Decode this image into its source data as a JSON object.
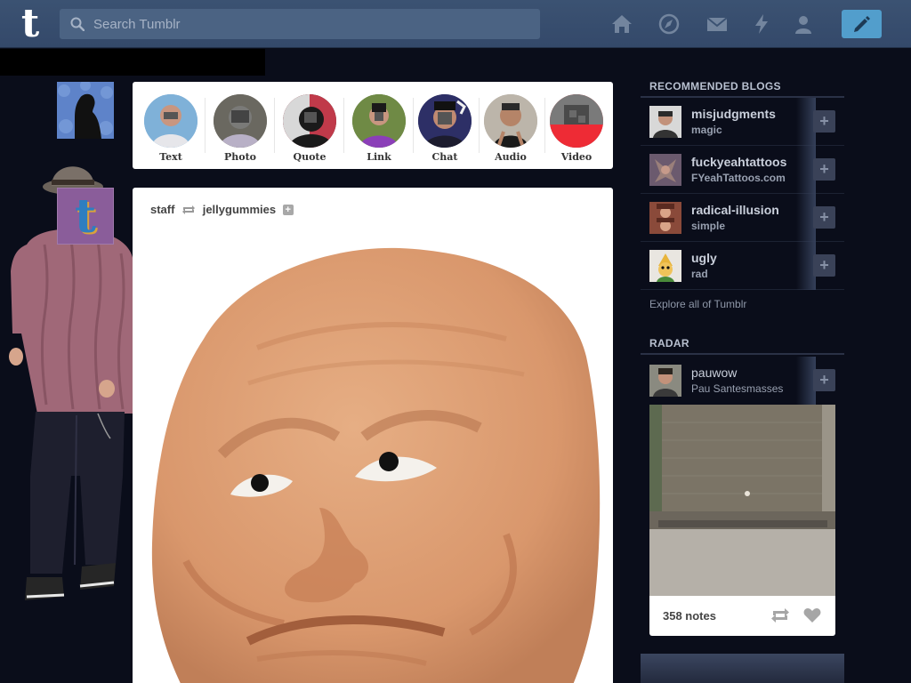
{
  "header": {
    "logo": "t",
    "search_placeholder": "Search Tumblr",
    "icons": [
      "home-icon",
      "explore-icon",
      "inbox-icon",
      "activity-icon",
      "account-icon"
    ],
    "compose_icon": "pencil-icon",
    "accent": "#529ecc"
  },
  "post_types": [
    {
      "label": "Text"
    },
    {
      "label": "Photo"
    },
    {
      "label": "Quote"
    },
    {
      "label": "Link"
    },
    {
      "label": "Chat"
    },
    {
      "label": "Audio"
    },
    {
      "label": "Video"
    }
  ],
  "post": {
    "author": "staff",
    "reblogged_from": "jellygummies",
    "follow": "+"
  },
  "sidebar": {
    "recommended_title": "RECOMMENDED BLOGS",
    "recommended": [
      {
        "name": "misjudgments",
        "title": "magic"
      },
      {
        "name": "fuckyeahtattoos",
        "title": "FYeahTattoos.com"
      },
      {
        "name": "radical-illusion",
        "title": "simple"
      },
      {
        "name": "ugly",
        "title": "rad"
      }
    ],
    "follow_label": "+",
    "explore": "Explore all of Tumblr",
    "radar_title": "RADAR",
    "radar": {
      "name": "pauwow",
      "title": "Pau Santesmasses",
      "notes": "358 notes"
    }
  }
}
